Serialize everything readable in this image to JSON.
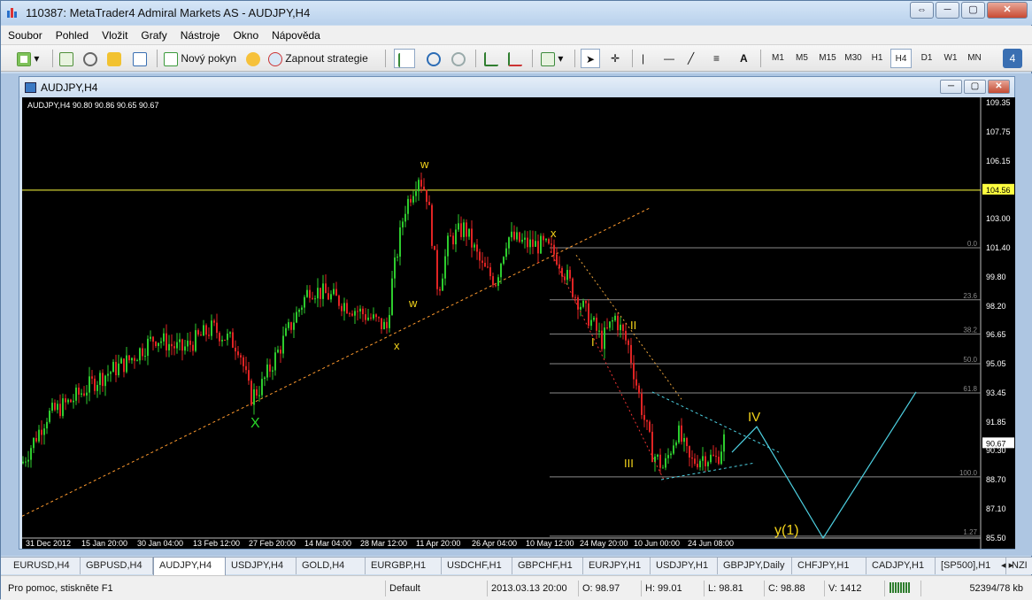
{
  "window": {
    "title": "110387: MetaTrader4 Admiral Markets AS - AUDJPY,H4"
  },
  "menu": [
    "Soubor",
    "Pohled",
    "Vložit",
    "Grafy",
    "Nástroje",
    "Okno",
    "Nápověda"
  ],
  "toolbar": {
    "new_order": "Nový pokyn",
    "autotrading": "Zapnout strategie",
    "timeframes": [
      "M1",
      "M5",
      "M15",
      "M30",
      "H1",
      "H4",
      "D1",
      "W1",
      "MN"
    ],
    "active_timeframe": "H4",
    "text_tool": "A"
  },
  "chart_window": {
    "title": "AUDJPY,H4"
  },
  "chart": {
    "ticker": "AUDJPY,H4  90.80 90.86 90.65 90.67",
    "price_levels": [
      "109.35",
      "107.75",
      "106.15",
      "104.56",
      "103.00",
      "101.40",
      "99.80",
      "98.20",
      "96.65",
      "95.05",
      "93.45",
      "91.85",
      "90.67",
      "90.30",
      "88.70",
      "87.10",
      "85.50"
    ],
    "current_price": "90.67",
    "hline_price": "104.56",
    "dates": [
      "31 Dec 2012",
      "15 Jan 20:00",
      "30 Jan 04:00",
      "13 Feb 12:00",
      "27 Feb 20:00",
      "14 Mar 04:00",
      "28 Mar 12:00",
      "11 Apr 20:00",
      "26 Apr 04:00",
      "10 May 12:00",
      "24 May 20:00",
      "10 Jun 00:00",
      "24 Jun 08:00"
    ],
    "fib_levels": [
      "0.0",
      "23.6",
      "38.2",
      "50.0",
      "61.8",
      "100.0",
      "1.27"
    ],
    "wave_labels": [
      "X",
      "w",
      "w",
      "x",
      "x",
      "I",
      "II",
      "III",
      "IV",
      "y(1)"
    ],
    "colors": {
      "bull": "#2ecc2e",
      "bear": "#e02424",
      "hline": "#ffff40",
      "label": "#f5d51b",
      "fib": "#8a8a8a",
      "projection": "#4dd0e1",
      "trend": "#ff9a2e"
    }
  },
  "tabs": [
    "EURUSD,H4",
    "GBPUSD,H4",
    "AUDJPY,H4",
    "USDJPY,H4",
    "GOLD,H4",
    "EURGBP,H1",
    "USDCHF,H1",
    "GBPCHF,H1",
    "EURJPY,H1",
    "USDJPY,H1",
    "GBPJPY,Daily",
    "CHFJPY,H1",
    "CADJPY,H1",
    "[SP500],H1",
    "NZI"
  ],
  "active_tab": "AUDJPY,H4",
  "status": {
    "help": "Pro pomoc, stiskněte F1",
    "profile": "Default",
    "datetime": "2013.03.13 20:00",
    "open": "O: 98.97",
    "high": "H: 99.01",
    "low": "L: 98.81",
    "close": "C: 98.88",
    "volume": "V: 1412",
    "traffic": "52394/78 kb"
  }
}
